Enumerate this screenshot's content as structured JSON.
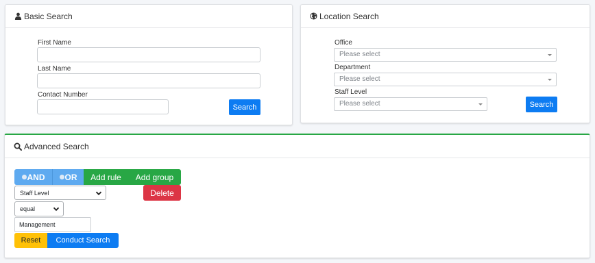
{
  "basic_search": {
    "title": "Basic Search",
    "first_name_label": "First Name",
    "first_name_value": "",
    "last_name_label": "Last Name",
    "last_name_value": "",
    "contact_label": "Contact Number",
    "contact_value": "",
    "search_button": "Search"
  },
  "location_search": {
    "title": "Location Search",
    "office_label": "Office",
    "office_value": "Please select",
    "department_label": "Department",
    "department_value": "Please select",
    "staff_level_label": "Staff Level",
    "staff_level_value": "Please select",
    "search_button": "Search"
  },
  "advanced_search": {
    "title": "Advanced Search",
    "and_label": "AND",
    "or_label": "OR",
    "add_rule_label": "Add rule",
    "add_group_label": "Add group",
    "field_value": "Staff Level",
    "delete_label": "Delete",
    "operator_value": "equal",
    "rule_value": "Management",
    "reset_label": "Reset",
    "conduct_search_label": "Conduct Search"
  },
  "icons": {
    "basic": "user-icon",
    "location": "globe-icon",
    "advanced": "search-icon"
  },
  "colors": {
    "primary": "#0d7cf2",
    "success": "#28a745",
    "danger": "#dc3545",
    "warning": "#ffc107",
    "condition_button": "#5eaaf0"
  }
}
